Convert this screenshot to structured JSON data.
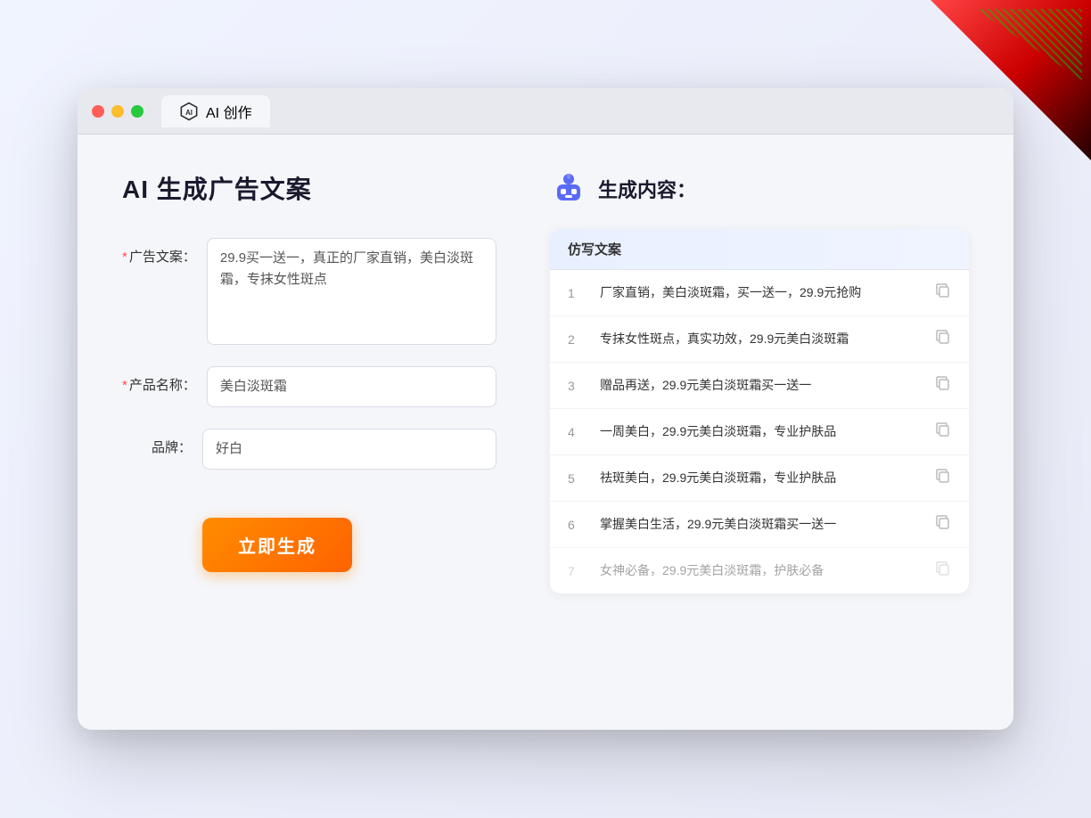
{
  "window": {
    "tab_label": "AI 创作"
  },
  "page": {
    "title": "AI 生成广告文案",
    "right_title": "生成内容："
  },
  "form": {
    "ad_copy_label": "广告文案：",
    "ad_copy_required": true,
    "ad_copy_value": "29.9买一送一，真正的厂家直销，美白淡斑霜，专抹女性斑点",
    "product_name_label": "产品名称：",
    "product_name_required": true,
    "product_name_value": "美白淡斑霜",
    "brand_label": "品牌：",
    "brand_required": false,
    "brand_value": "好白",
    "generate_button": "立即生成"
  },
  "results": {
    "column_header": "仿写文案",
    "items": [
      {
        "num": "1",
        "text": "厂家直销，美白淡斑霜，买一送一，29.9元抢购",
        "dimmed": false
      },
      {
        "num": "2",
        "text": "专抹女性斑点，真实功效，29.9元美白淡斑霜",
        "dimmed": false
      },
      {
        "num": "3",
        "text": "赠品再送，29.9元美白淡斑霜买一送一",
        "dimmed": false
      },
      {
        "num": "4",
        "text": "一周美白，29.9元美白淡斑霜，专业护肤品",
        "dimmed": false
      },
      {
        "num": "5",
        "text": "祛斑美白，29.9元美白淡斑霜，专业护肤品",
        "dimmed": false
      },
      {
        "num": "6",
        "text": "掌握美白生活，29.9元美白淡斑霜买一送一",
        "dimmed": false
      },
      {
        "num": "7",
        "text": "女神必备，29.9元美白淡斑霜，护肤必备",
        "dimmed": true
      }
    ]
  }
}
